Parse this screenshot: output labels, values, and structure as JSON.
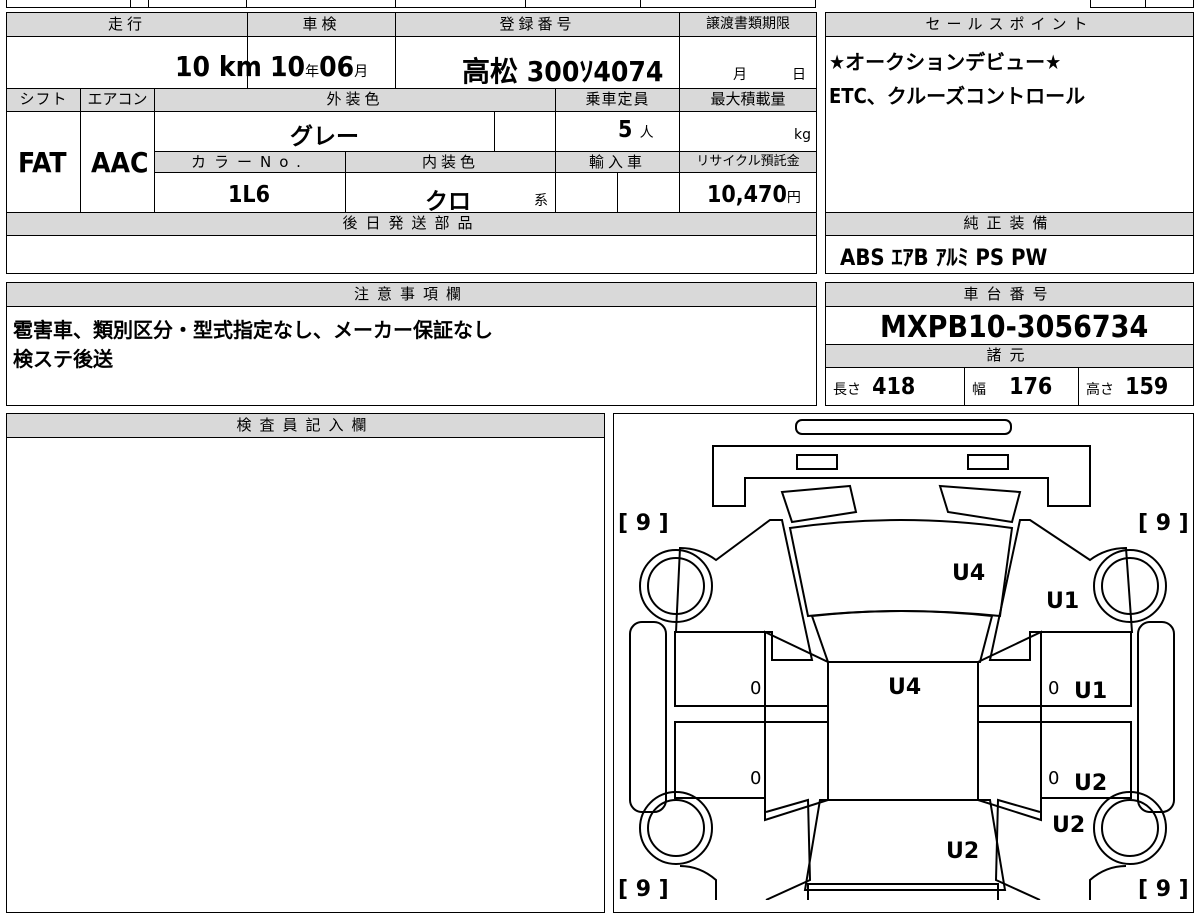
{
  "top_row": {
    "mileage": {
      "label": "走行",
      "value": "10",
      "unit": "km"
    },
    "inspection": {
      "label": "車検",
      "year": "10",
      "year_unit": "年",
      "month": "06",
      "month_unit": "月"
    },
    "registration": {
      "label": "登録番号",
      "value": "高松 300ｿ4074"
    },
    "transfer_deadline": {
      "label": "譲渡書類期限",
      "month_unit": "月",
      "day_unit": "日"
    }
  },
  "middle": {
    "shift": {
      "label": "シフト",
      "value": "FAT"
    },
    "aircon": {
      "label": "エアコン",
      "value": "AAC"
    },
    "exterior_color": {
      "label": "外装色",
      "value": "グレー"
    },
    "capacity": {
      "label": "乗車定員",
      "value": "5",
      "unit": "人"
    },
    "max_load": {
      "label": "最大積載量",
      "unit": "kg"
    },
    "color_no": {
      "label": "カラーNo.",
      "value": "1L6"
    },
    "interior_color": {
      "label": "内装色",
      "value": "クロ",
      "suffix": "系"
    },
    "import": {
      "label": "輸入車"
    },
    "recycle_fee": {
      "label": "リサイクル預託金",
      "value": "10,470",
      "unit": "円"
    }
  },
  "later_parts": {
    "label": "後日発送部品",
    "value": ""
  },
  "sales_points": {
    "label": "セールスポイント",
    "lines": [
      "★オークションデビュー★",
      "ETC、クルーズコントロール"
    ]
  },
  "equipment": {
    "label": "純正装備",
    "value": "ABS ｴｱB ｱﾙﾐ PS PW"
  },
  "notes": {
    "label": "注意事項欄",
    "lines": [
      "雹害車、類別区分・型式指定なし、メーカー保証なし",
      "検ステ後送"
    ]
  },
  "chassis": {
    "label": "車台番号",
    "value": "MXPB10-3056734"
  },
  "specs": {
    "label": "諸元",
    "length": {
      "label": "長さ",
      "value": "418"
    },
    "width": {
      "label": "幅",
      "value": "176"
    },
    "height": {
      "label": "高さ",
      "value": "159"
    }
  },
  "inspector": {
    "label": "検査員記入欄",
    "value": ""
  },
  "diagram": {
    "tire_tl": "[ 9 ]",
    "tire_tr": "[ 9 ]",
    "tire_bl": "[ 9 ]",
    "tire_br": "[ 9 ]",
    "marks": {
      "hood": "U4",
      "front_fender_right": "U1",
      "roof": "U4",
      "front_door_right": "U1",
      "rear_door_right": "U2",
      "rear_fender_right": "U2",
      "trunk": "U2"
    },
    "door_zero": "0"
  }
}
